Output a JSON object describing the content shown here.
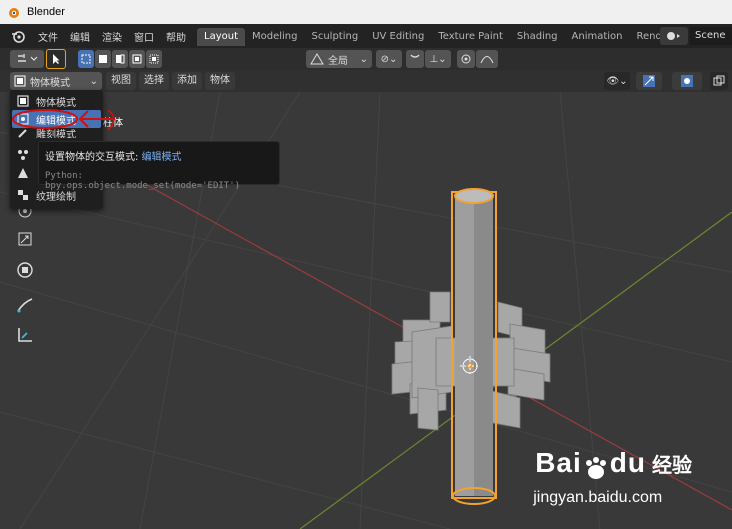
{
  "window": {
    "title": "Blender"
  },
  "menubar": {
    "items": [
      "文件",
      "编辑",
      "渲染",
      "窗口",
      "帮助"
    ]
  },
  "workspace_tabs": [
    {
      "label": "Layout",
      "active": true
    },
    {
      "label": "Modeling",
      "active": false
    },
    {
      "label": "Sculpting",
      "active": false
    },
    {
      "label": "UV Editing",
      "active": false
    },
    {
      "label": "Texture Paint",
      "active": false
    },
    {
      "label": "Shading",
      "active": false
    },
    {
      "label": "Animation",
      "active": false
    },
    {
      "label": "Rendering",
      "active": false
    }
  ],
  "scene": {
    "label": "Scene"
  },
  "tool_header": {
    "transform_orientation": "全局"
  },
  "viewport_header": {
    "mode_select": "物体模式",
    "menus": [
      "视图",
      "选择",
      "添加",
      "物体"
    ]
  },
  "viewport": {
    "object_label": "ion | 柱体"
  },
  "mode_dropdown": {
    "items": [
      "物体模式",
      "编辑模式",
      "雕刻模式",
      "",
      "",
      "纹理绘制"
    ],
    "selected_index": 1
  },
  "tooltip": {
    "line1_prefix": "设置物体的交互模式: ",
    "line1_value": "编辑模式",
    "line2": "Python: bpy.ops.object.mode_set(mode='EDIT')"
  },
  "watermark": {
    "brand": "Bai",
    "brand_suffix": "du",
    "cn": "经验",
    "url": "jingyan.baidu.com"
  },
  "colors": {
    "accent": "#4772b3",
    "selection_outline": "#f2a22f",
    "x_axis": "#9c3b3b",
    "y_axis": "#6b8a2e",
    "annotation": "#d01010"
  }
}
